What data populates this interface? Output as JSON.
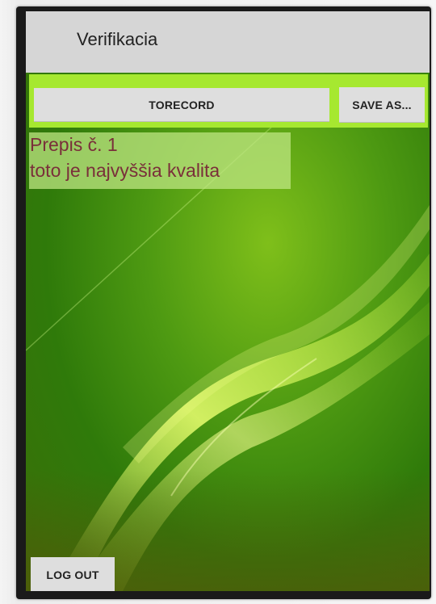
{
  "app": {
    "title": "Verifikacia"
  },
  "toolbar": {
    "record_label": "TORECORD",
    "save_as_label": "SAVE AS..."
  },
  "transcript": {
    "line_1": "Prepis č. 1",
    "line_2": "toto je najvyššia kvalita"
  },
  "footer": {
    "logout_label": "LOG OUT"
  },
  "colors": {
    "action_bar": "#d6d6d6",
    "toolbar_highlight": "#a6e830",
    "button": "#dedede",
    "transcript_text": "#7a2f3a",
    "wallpaper_green": "#4e9a12"
  }
}
